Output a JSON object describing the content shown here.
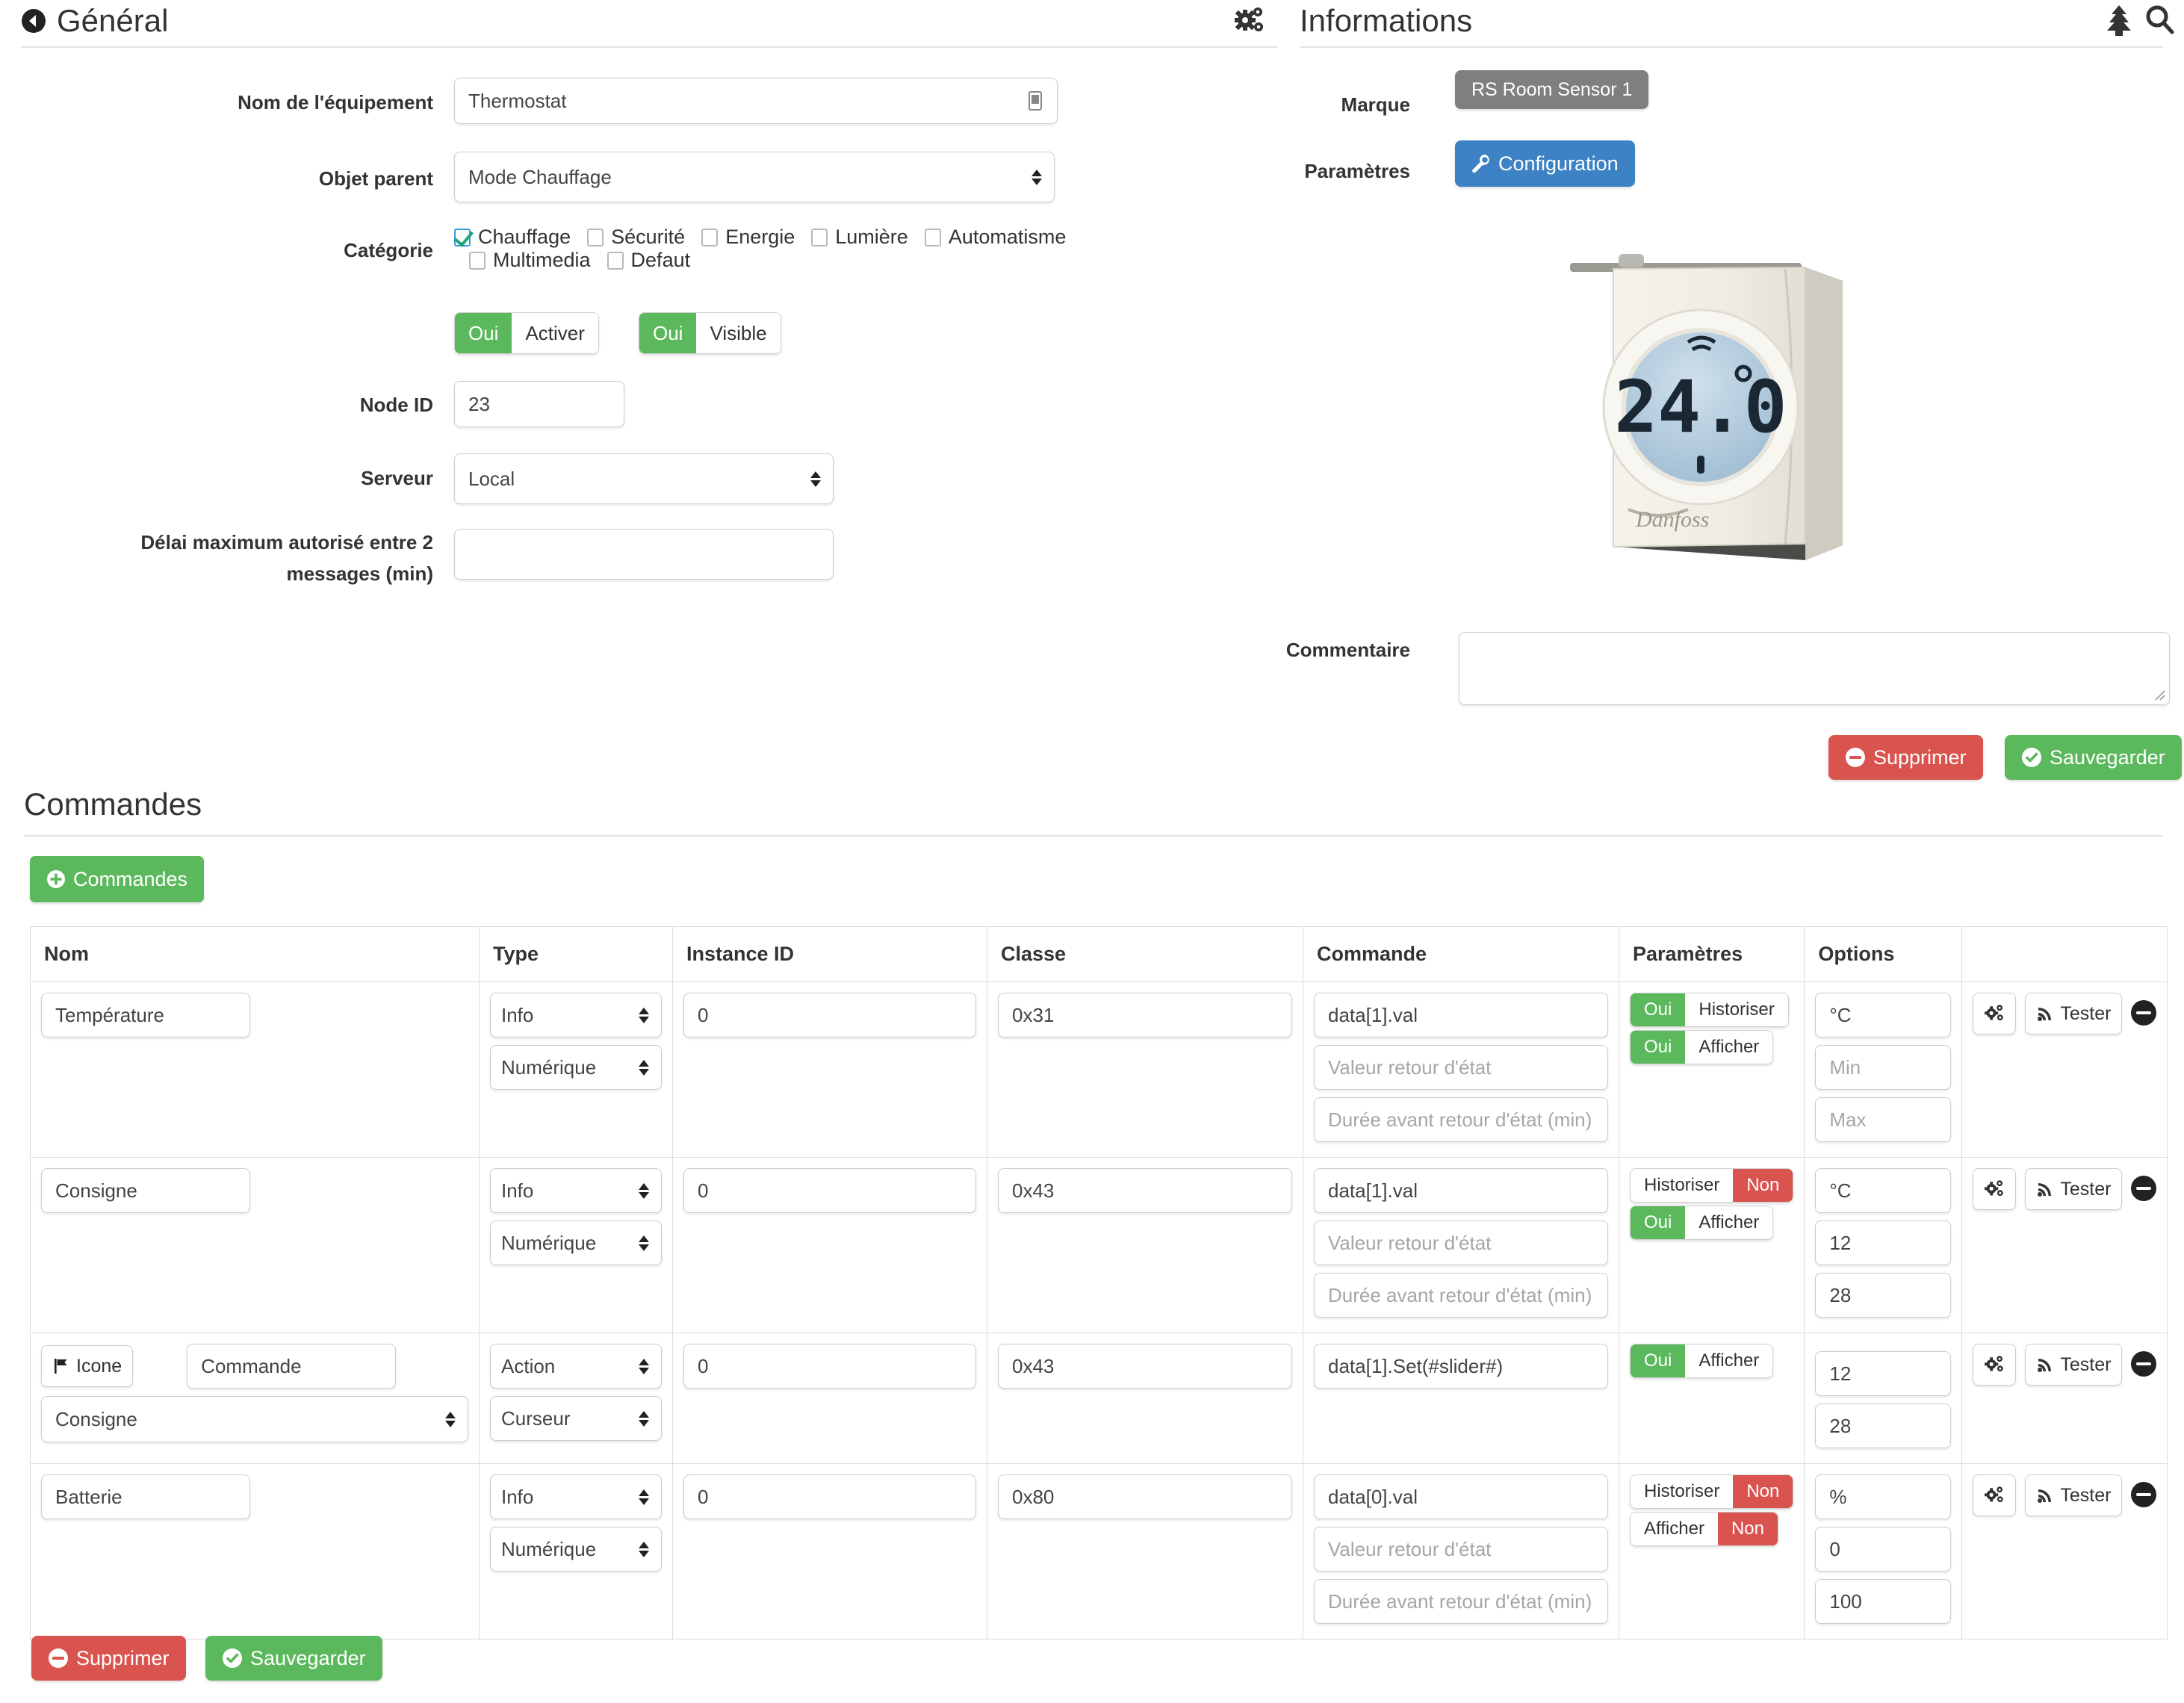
{
  "general": {
    "title": "Général",
    "back_icon": "arrow-circle-left-icon",
    "cogs_icon": "cogs-icon",
    "fields": {
      "name_label": "Nom de l'équipement",
      "name_value": "Thermostat",
      "name_addon_icon": "mobile-icon",
      "parent_label": "Objet parent",
      "parent_value": "Mode Chauffage",
      "category_label": "Catégorie",
      "node_id_label": "Node ID",
      "node_id_value": "23",
      "server_label": "Serveur",
      "server_value": "Local",
      "delay_label": "Délai maximum autorisé entre 2 messages (min)",
      "delay_value": ""
    },
    "categories": [
      {
        "label": "Chauffage",
        "checked": true
      },
      {
        "label": "Sécurité",
        "checked": false
      },
      {
        "label": "Energie",
        "checked": false
      },
      {
        "label": "Lumière",
        "checked": false
      },
      {
        "label": "Automatisme",
        "checked": false
      },
      {
        "label": "Multimedia",
        "checked": false
      },
      {
        "label": "Defaut",
        "checked": false
      }
    ],
    "toggles": [
      {
        "state": "Oui",
        "label": "Activer",
        "on": true
      },
      {
        "state": "Oui",
        "label": "Visible",
        "on": true
      }
    ]
  },
  "informations": {
    "title": "Informations",
    "tree_icon": "tree-icon",
    "search_icon": "search-icon",
    "brand_label": "Marque",
    "brand_value": "RS Room Sensor 1",
    "params_label": "Paramètres",
    "config_button": "Configuration",
    "config_icon": "wrench-icon",
    "device_image_alt": "danfoss-thermostat-photo",
    "device_display_value": "24.0",
    "comment_label": "Commentaire",
    "comment_value": "",
    "delete_button": "Supprimer",
    "save_button": "Sauvegarder",
    "delete_icon": "minus-circle-icon",
    "save_icon": "check-circle-icon"
  },
  "commandes": {
    "title": "Commandes",
    "add_button": "Commandes",
    "add_icon": "plus-circle-icon",
    "columns": [
      "Nom",
      "Type",
      "Instance ID",
      "Classe",
      "Commande",
      "Paramètres",
      "Options",
      ""
    ],
    "placeholders": {
      "retour_valeur": "Valeur retour d'état",
      "retour_duree": "Durée avant retour d'état (min)",
      "min": "Min",
      "max": "Max"
    },
    "action_icons": {
      "config": "cogs-icon",
      "test": "rss-icon",
      "remove": "minus-circle-icon"
    },
    "test_button": "Tester",
    "rows": [
      {
        "name": "Température",
        "name_is_icon_row": false,
        "type": "Info",
        "subtype": "Numérique",
        "instance_id": "0",
        "classe": "0x31",
        "commande": "data[1].val",
        "retour_valeur": "",
        "retour_duree": "",
        "params": [
          {
            "state": "Oui",
            "label": "Historiser",
            "on": true,
            "state_first": true
          },
          {
            "state": "Oui",
            "label": "Afficher",
            "on": true,
            "state_first": true
          }
        ],
        "options": [
          "°C",
          "",
          ""
        ],
        "options_placeholders": [
          "",
          "Min",
          "Max"
        ]
      },
      {
        "name": "Consigne",
        "name_is_icon_row": false,
        "type": "Info",
        "subtype": "Numérique",
        "instance_id": "0",
        "classe": "0x43",
        "commande": "data[1].val",
        "retour_valeur": "",
        "retour_duree": "",
        "params": [
          {
            "state": "Non",
            "label": "Historiser",
            "on": false,
            "state_first": false
          },
          {
            "state": "Oui",
            "label": "Afficher",
            "on": true,
            "state_first": true
          }
        ],
        "options": [
          "°C",
          "12",
          "28"
        ],
        "options_placeholders": [
          "",
          "",
          ""
        ]
      },
      {
        "name": "Consigne",
        "name_is_icon_row": true,
        "icon_button": "Icone",
        "icon_button_icon": "flag-icon",
        "commande_label": "Commande",
        "type": "Action",
        "subtype": "Curseur",
        "instance_id": "0",
        "classe": "0x43",
        "commande": "data[1].Set(#slider#)",
        "params": [
          {
            "state": "Oui",
            "label": "Afficher",
            "on": true,
            "state_first": true
          }
        ],
        "options": [
          "12",
          "28"
        ],
        "options_placeholders": [
          "",
          ""
        ]
      },
      {
        "name": "Batterie",
        "name_is_icon_row": false,
        "type": "Info",
        "subtype": "Numérique",
        "instance_id": "0",
        "classe": "0x80",
        "commande": "data[0].val",
        "retour_valeur": "",
        "retour_duree": "",
        "params": [
          {
            "state": "Non",
            "label": "Historiser",
            "on": false,
            "state_first": false
          },
          {
            "state": "Non",
            "label": "Afficher",
            "on": false,
            "state_first": false
          }
        ],
        "options": [
          "%",
          "0",
          "100"
        ],
        "options_placeholders": [
          "",
          "",
          ""
        ]
      }
    ],
    "footer": {
      "delete_button": "Supprimer",
      "save_button": "Sauvegarder",
      "delete_icon": "minus-circle-icon",
      "save_icon": "check-circle-icon"
    }
  },
  "colors": {
    "green": "#5cb85c",
    "red": "#d9534f",
    "blue": "#3c82c4",
    "grey": "#7f7f7f"
  }
}
